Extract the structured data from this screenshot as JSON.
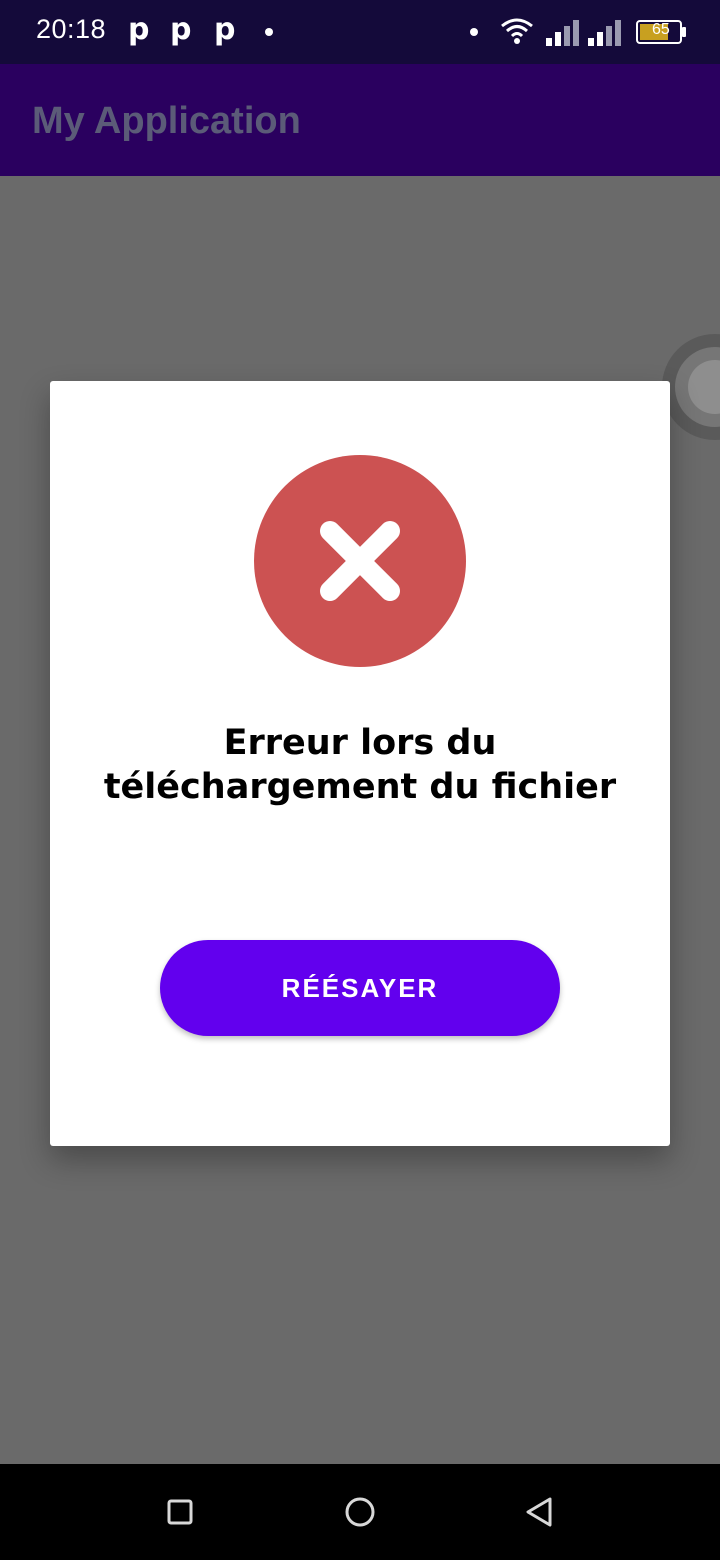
{
  "status_bar": {
    "time": "20:18",
    "notification_letters": [
      "p",
      "p",
      "p"
    ],
    "battery_level": "65",
    "icons": [
      "notification-dot-icon",
      "wifi-icon",
      "signal-icon",
      "battery-icon"
    ]
  },
  "app_bar": {
    "title": "My Application"
  },
  "dialog": {
    "icon": "error-x-icon",
    "icon_color": "#cc5252",
    "message": "Erreur lors du téléchargement du fichier",
    "retry_label": "RÉÉSAYER",
    "button_color": "#6200ee"
  },
  "nav_bar": {
    "icons": [
      "recents-square-icon",
      "home-circle-icon",
      "back-triangle-icon"
    ]
  }
}
